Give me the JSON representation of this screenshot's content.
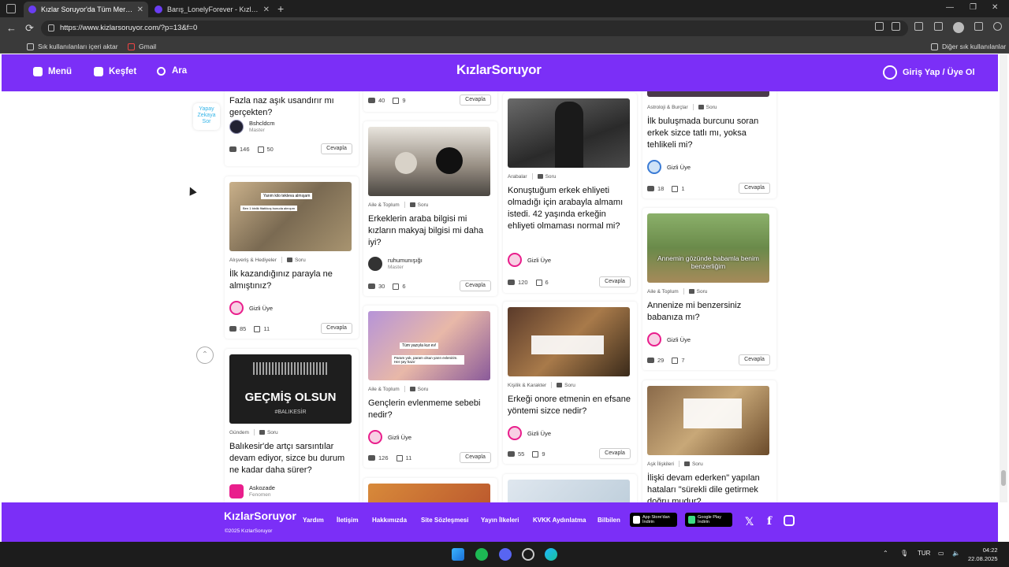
{
  "browser": {
    "tabs": [
      {
        "title": "Kızlar Soruyor'da Tüm Merak Ettik",
        "active": true
      },
      {
        "title": "Barış_LonelyForever - KızlarSoruy",
        "active": false
      }
    ],
    "url": "https://www.kizlarsoruyor.com/?p=13&f=0",
    "bookmarks": [
      "Sık kullanılanları içeri aktar",
      "Gmail"
    ],
    "other_favorites": "Diğer sık kullanılanlar"
  },
  "header": {
    "menu": "Menü",
    "explore": "Keşfet",
    "search": "Ara",
    "logo": "KızlarSoruyor",
    "login": "Giriş Yap / Üye Ol"
  },
  "ai_chip": "Yapay Zekaya Sor",
  "reply_label": "Cevapla",
  "columns": {
    "col1": [
      {
        "title": "Fazla naz aşık usandırır mı gerçekten?",
        "author": "Bshcldcm",
        "rank": "Master",
        "comments": "146",
        "likes": "50"
      },
      {
        "category": "Alışveriş & Hediyeler",
        "type": "Soru",
        "title": "İlk kazandığınız parayla ne almıştınız?",
        "author": "Gizli Üye",
        "comments": "85",
        "likes": "11",
        "img_text1": "Yarım kilo tekleva almışam",
        "img_text2": "Ben 1 binlik fitatlıkoş bunuda almışım"
      },
      {
        "category": "Gündem",
        "type": "Soru",
        "title": "Balıkesir'de artçı sarsıntılar devam ediyor, sizce bu durum ne kadar daha sürer?",
        "author": "Askozade",
        "rank": "Fenomen",
        "img_text1": "GEÇMİŞ OLSUN",
        "img_text2": "#BALIKESİR"
      }
    ],
    "col2": [
      {
        "comments": "40",
        "likes": "9"
      },
      {
        "category": "Aile & Toplum",
        "type": "Soru",
        "title": "Erkeklerin araba bilgisi mi kızların makyaj bilgisi mi daha iyi?",
        "author": "ruhumunışığı",
        "rank": "Master",
        "comments": "30",
        "likes": "6"
      },
      {
        "category": "Aile & Toplum",
        "type": "Soru",
        "title": "Gençlerin evlenmeme sebebi nedir?",
        "author": "Gizli Üye",
        "comments": "126",
        "likes": "11",
        "img_text1": "Tüm yazıyla kur ev!",
        "img_text2": "Param yok, param olsun yarın evlenirim. Her şey hazır"
      }
    ],
    "col3": [
      {
        "category": "Arabalar",
        "type": "Soru",
        "title": "Konuştuğum erkek ehliyeti olmadığı için arabayla almamı istedi. 42 yaşında erkeğin ehliyeti olmaması normal mi?",
        "author": "Gizli Üye",
        "comments": "120",
        "likes": "6"
      },
      {
        "category": "Kişilik & Karakter",
        "type": "Soru",
        "title": "Erkeği onore etmenin en efsane yöntemi sizce nedir?",
        "author": "Gizli Üye",
        "comments": "55",
        "likes": "9"
      }
    ],
    "col4": [
      {
        "category": "Astroloji & Burçlar",
        "type": "Soru",
        "title": "İlk buluşmada burcunu soran erkek sizce tatlı mı, yoksa tehlikeli mi?",
        "author": "Gizli Üye",
        "comments": "18",
        "likes": "1"
      },
      {
        "category": "Aile & Toplum",
        "type": "Soru",
        "title": "Annenize mi benzersiniz babanıza mı?",
        "author": "Gizli Üye",
        "comments": "29",
        "likes": "7",
        "img_text1": "Annemin gözünde babamla benim benzerliğim"
      },
      {
        "category": "Aşk İlişkileri",
        "type": "Soru",
        "title": "İlişki devam ederken\" yapılan hataları \"sürekli dile getirmek doğru mudur?"
      }
    ]
  },
  "footer": {
    "logo": "KızlarSoruyor",
    "copyright": "©2025 KızlarSoruyor",
    "links": [
      "Yardım",
      "İletişim",
      "Hakkımızda",
      "Site Sözleşmesi",
      "Yayın İlkeleri",
      "KVKK Aydınlatma",
      "Bilbilen"
    ],
    "appstore": {
      "line1": "App Store'dan",
      "line2": "İndirin"
    },
    "googleplay": {
      "line1": "Google Play",
      "line2": "İndirin"
    }
  },
  "taskbar": {
    "lang": "TUR",
    "time": "04:22",
    "date": "22.08.2025"
  },
  "colors": {
    "brand": "#7b2ff7",
    "avatar_pink": "#e91e8c"
  }
}
